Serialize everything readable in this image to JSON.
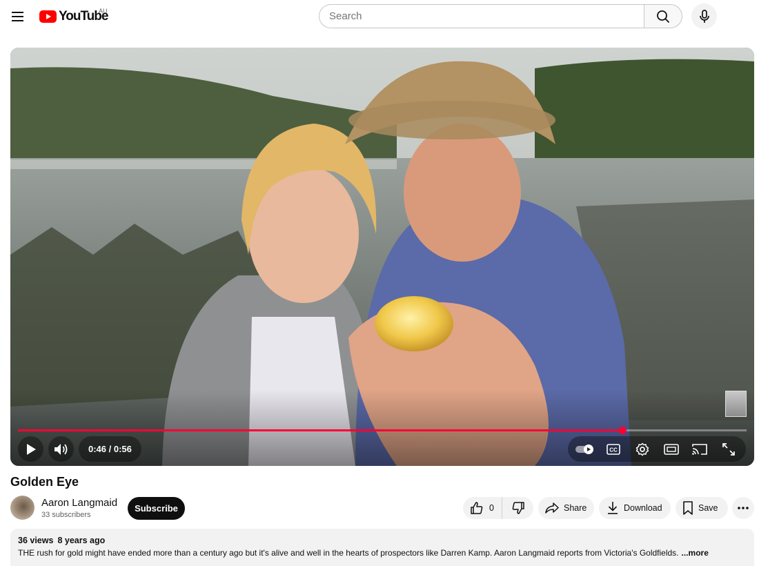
{
  "header": {
    "logo_text": "YouTube",
    "region": "AU",
    "search_placeholder": "Search"
  },
  "player": {
    "current_time": "0:46",
    "duration": "0:56",
    "time_display": "0:46 / 0:56",
    "progress_fraction": 0.83,
    "icons": [
      "play-icon",
      "volume-icon",
      "autoplay-toggle-icon",
      "captions-icon",
      "settings-icon",
      "theater-mode-icon",
      "cast-icon",
      "fullscreen-icon"
    ]
  },
  "video": {
    "title": "Golden Eye"
  },
  "owner": {
    "name": "Aaron Langmaid",
    "subscribers": "33 subscribers",
    "subscribe_label": "Subscribe"
  },
  "actions": {
    "like_count": "0",
    "share_label": "Share",
    "download_label": "Download",
    "save_label": "Save"
  },
  "description": {
    "views": "36 views",
    "age": "8 years ago",
    "text": "THE rush for gold might have ended more than a century ago but it's alive and well in the hearts of prospectors like Darren Kamp. Aaron Langmaid reports from Victoria's Goldfields.",
    "more_label": "...more"
  },
  "colors": {
    "accent": "#ff0000",
    "progress": "#ff0033",
    "pill_bg": "#f2f2f2"
  }
}
